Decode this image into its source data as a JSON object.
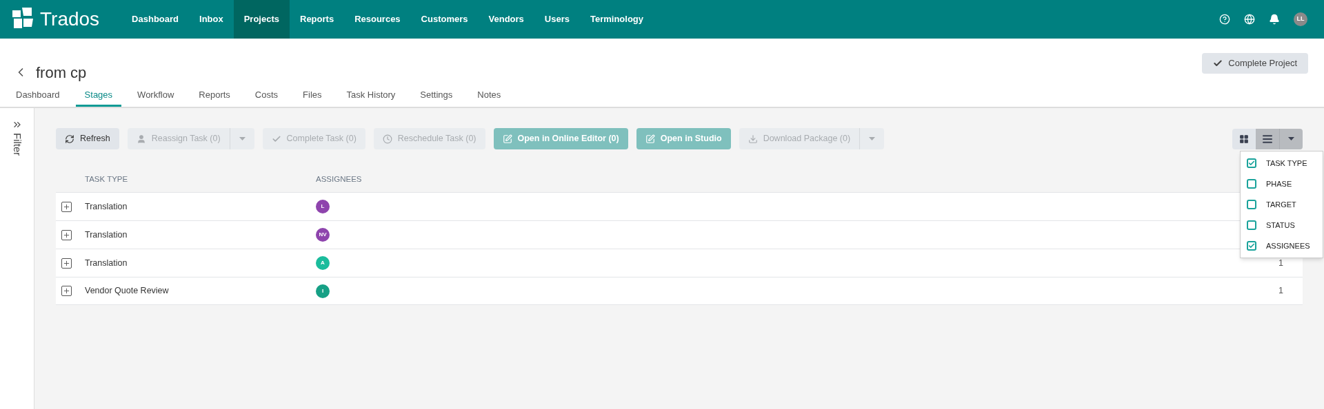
{
  "nav": {
    "logo": "Trados",
    "items": [
      {
        "label": "Dashboard",
        "selected": false
      },
      {
        "label": "Inbox",
        "selected": false
      },
      {
        "label": "Projects",
        "selected": true
      },
      {
        "label": "Reports",
        "selected": false
      },
      {
        "label": "Resources",
        "selected": false
      },
      {
        "label": "Customers",
        "selected": false
      },
      {
        "label": "Vendors",
        "selected": false
      },
      {
        "label": "Users",
        "selected": false
      },
      {
        "label": "Terminology",
        "selected": false
      }
    ],
    "avatar": "LL"
  },
  "project": {
    "title": "from cp",
    "complete_button": "Complete Project"
  },
  "tabs": [
    {
      "label": "Dashboard",
      "selected": false
    },
    {
      "label": "Stages",
      "selected": true
    },
    {
      "label": "Workflow",
      "selected": false
    },
    {
      "label": "Reports",
      "selected": false
    },
    {
      "label": "Costs",
      "selected": false
    },
    {
      "label": "Files",
      "selected": false
    },
    {
      "label": "Task History",
      "selected": false
    },
    {
      "label": "Settings",
      "selected": false
    },
    {
      "label": "Notes",
      "selected": false
    }
  ],
  "filter": {
    "label": "Filter"
  },
  "toolbar": [
    {
      "label": "Refresh",
      "kind": "refresh",
      "disabled": false,
      "primary": false,
      "split": false
    },
    {
      "label": "Reassign Task (0)",
      "kind": "user",
      "disabled": true,
      "primary": false,
      "split": true
    },
    {
      "label": "Complete Task (0)",
      "kind": "check",
      "disabled": true,
      "primary": false,
      "split": false
    },
    {
      "label": "Reschedule Task (0)",
      "kind": "clock",
      "disabled": true,
      "primary": false,
      "split": false
    },
    {
      "label": "Open in Online Editor (0)",
      "kind": "edit",
      "disabled": false,
      "primary": true,
      "split": false
    },
    {
      "label": "Open in Studio",
      "kind": "edit",
      "disabled": false,
      "primary": true,
      "split": false
    },
    {
      "label": "Download Package (0)",
      "kind": "download",
      "disabled": true,
      "primary": false,
      "split": true
    }
  ],
  "view_toggle": [
    {
      "kind": "grid",
      "selected": false
    },
    {
      "kind": "list",
      "selected": true
    }
  ],
  "table": {
    "columns": [
      "TASK TYPE",
      "ASSIGNEES"
    ],
    "rows": [
      {
        "task_type": "Translation",
        "assignee": "L",
        "color": "#8e44ad"
      },
      {
        "task_type": "Translation",
        "assignee": "NV",
        "color": "#8e44ad"
      },
      {
        "task_type": "Translation",
        "assignee": "A",
        "color": "#1abc9c",
        "column_3": "1"
      },
      {
        "task_type": "Vendor Quote Review",
        "assignee": "I",
        "color": "#16a085",
        "column_3": "1"
      }
    ]
  },
  "column_menu": [
    {
      "label": "TASK TYPE",
      "checked": true
    },
    {
      "label": "PHASE",
      "checked": false
    },
    {
      "label": "TARGET",
      "checked": false
    },
    {
      "label": "STATUS",
      "checked": false
    },
    {
      "label": "ASSIGNEES",
      "checked": true
    }
  ]
}
